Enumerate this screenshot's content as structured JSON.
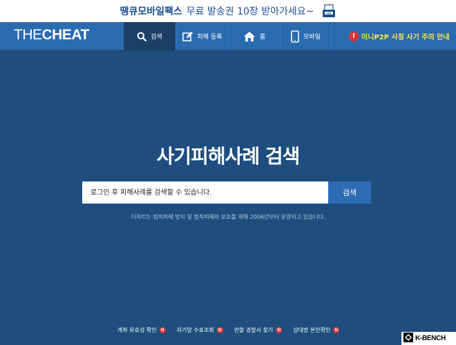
{
  "ad": {
    "bold": "땡큐모바일팩스",
    "rest": "무료 발송권 10장 받아가세요~",
    "fax_label": "FAX"
  },
  "header": {
    "logo_a": "THE",
    "logo_b": "CHEAT",
    "nav": [
      {
        "label": "검색",
        "icon": "search-icon"
      },
      {
        "label": "피해 등록",
        "icon": "edit-icon"
      },
      {
        "label": "홈",
        "icon": "home-icon"
      },
      {
        "label": "모바일",
        "icon": "mobile-icon"
      }
    ],
    "notice": "이니P2P 사칭 사기 주의 안내"
  },
  "main": {
    "title": "사기피해사례 검색",
    "search_placeholder": "로그인 후 피해사례를 검색할 수 있습니다.",
    "search_button": "검색",
    "description": "더치트는 범죄피해 방지 및 범죄피해자 보호를 위해 2006년부터 운영되고 있습니다."
  },
  "footer": {
    "links": [
      {
        "label": "계좌 유효성 확인",
        "badge": "N"
      },
      {
        "label": "자기앞 수표조회",
        "badge": "N"
      },
      {
        "label": "관할 경찰서 찾기",
        "badge": "N"
      },
      {
        "label": "상대방 본인확인",
        "badge": "N"
      }
    ]
  },
  "watermark": {
    "text": "K-BENCH"
  },
  "colors": {
    "background": "#1e4d7e",
    "navbar": "#2a6bb0",
    "nav_active": "#1c3f66",
    "search_button": "#2e6bb5",
    "notice": "#ffe640",
    "badge": "#e53b3b"
  }
}
